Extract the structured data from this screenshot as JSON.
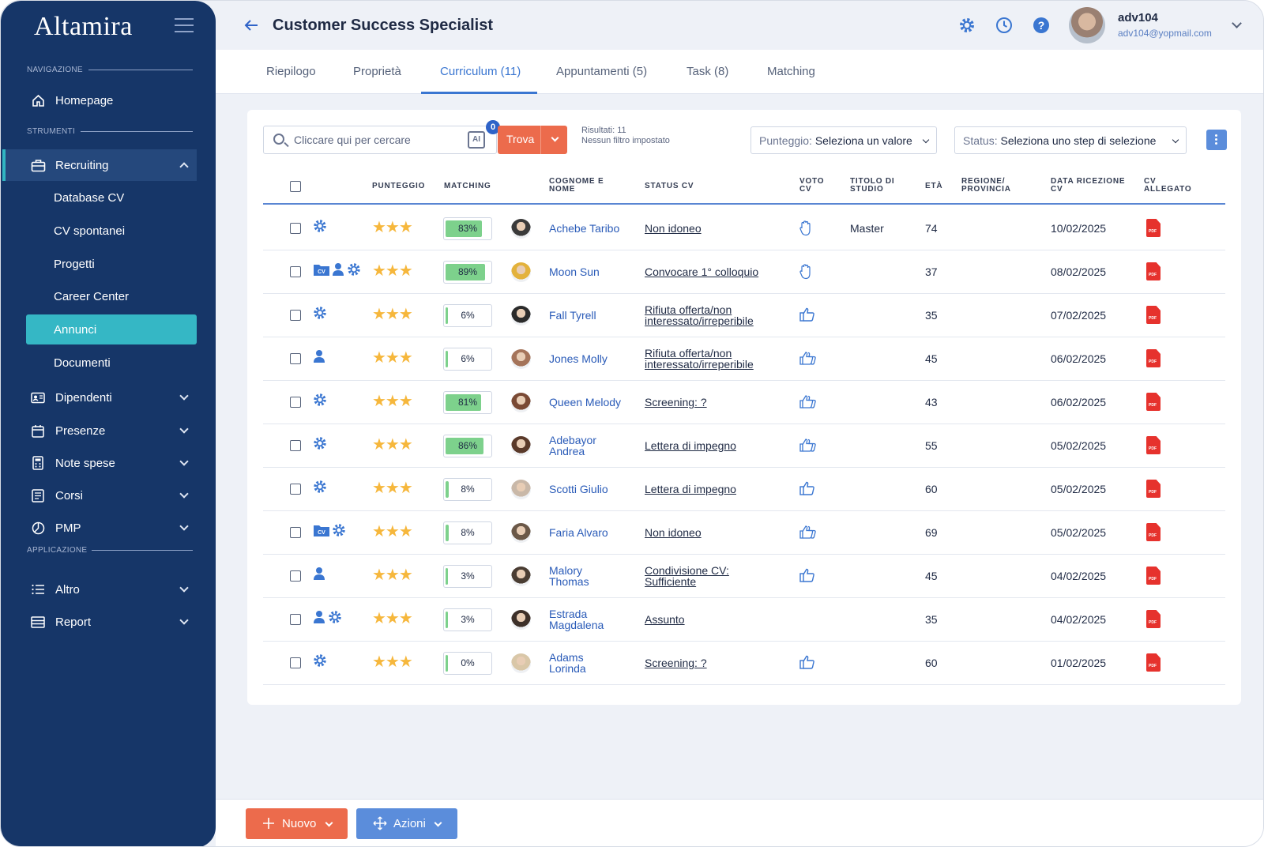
{
  "app": {
    "logo": "Altamira"
  },
  "sidebar": {
    "sections": {
      "nav": "NAVIGAZIONE",
      "tools": "STRUMENTI",
      "app": "APPLICAZIONE"
    },
    "homepage": "Homepage",
    "recruiting": "Recruiting",
    "recruiting_items": [
      "Database CV",
      "CV spontanei",
      "Progetti",
      "Career Center",
      "Annunci",
      "Documenti"
    ],
    "dipendenti": "Dipendenti",
    "presenze": "Presenze",
    "note_spese": "Note spese",
    "corsi": "Corsi",
    "pmp": "PMP",
    "altro": "Altro",
    "report": "Report"
  },
  "header": {
    "title": "Customer Success Specialist",
    "user_name": "adv104",
    "user_email": "adv104@yopmail.com"
  },
  "tabs": [
    "Riepilogo",
    "Proprietà",
    "Curriculum (11)",
    "Appuntamenti (5)",
    "Task (8)",
    "Matching"
  ],
  "toolbar": {
    "search_placeholder": "Cliccare qui per cercare",
    "ai_label": "AI",
    "ai_badge": "0",
    "trova": "Trova",
    "results": "Risultati: 11",
    "filter_note": "Nessun filtro impostato",
    "score_label": "Punteggio:",
    "score_value": "Seleziona un valore",
    "status_label": "Status:",
    "status_value": "Seleziona uno step di selezione"
  },
  "columns": {
    "punteggio": "PUNTEGGIO",
    "matching": "MATCHING",
    "nome_1": "COGNOME E",
    "nome_2": "NOME",
    "status": "STATUS CV",
    "voto_1": "VOTO",
    "voto_2": "CV",
    "titolo_1": "TITOLO DI",
    "titolo_2": "STUDIO",
    "eta": "ETÀ",
    "regione_1": "REGIONE/",
    "regione_2": "PROVINCIA",
    "data_1": "DATA RICEZIONE",
    "data_2": "CV",
    "allegato_1": "CV",
    "allegato_2": "ALLEGATO"
  },
  "rows": [
    {
      "icons": [
        "gear-icon"
      ],
      "stars": "★★★",
      "match": "83%",
      "match_fraction": 0.83,
      "name_1": "Achebe Taribo",
      "name_2": "",
      "status_1": "Non idoneo",
      "status_2": "",
      "vote": "hand-icon",
      "title": "Master",
      "age": "74",
      "date": "10/02/2025",
      "avatar_color": "#3a3a3a"
    },
    {
      "icons": [
        "cv-folder-icon",
        "person-icon",
        "gear-icon"
      ],
      "stars": "★★★",
      "match": "89%",
      "match_fraction": 0.89,
      "name_1": "Moon Sun",
      "name_2": "",
      "status_1": "Convocare 1° colloquio",
      "status_2": "",
      "vote": "hand-icon",
      "title": "",
      "age": "37",
      "date": "08/02/2025",
      "avatar_color": "#e3b23c"
    },
    {
      "icons": [
        "gear-icon"
      ],
      "stars": "★★★",
      "match": "6%",
      "match_fraction": 0.06,
      "name_1": "Fall Tyrell",
      "name_2": "",
      "status_1": "Rifiuta offerta/non",
      "status_2": "interessato/irreperibile",
      "vote": "thumb-up-icon",
      "title": "",
      "age": "35",
      "date": "07/02/2025",
      "avatar_color": "#2b2b2b"
    },
    {
      "icons": [
        "person-icon"
      ],
      "stars": "★★★",
      "match": "6%",
      "match_fraction": 0.06,
      "name_1": "Jones Molly",
      "name_2": "",
      "status_1": "Rifiuta offerta/non",
      "status_2": "interessato/irreperibile",
      "vote": "double-thumb-icon",
      "title": "",
      "age": "45",
      "date": "06/02/2025",
      "avatar_color": "#a5745a"
    },
    {
      "icons": [
        "gear-icon"
      ],
      "stars": "★★★",
      "match": "81%",
      "match_fraction": 0.81,
      "name_1": "Queen Melody",
      "name_2": "",
      "status_1": "Screening: ?",
      "status_2": "",
      "vote": "double-thumb-icon",
      "title": "",
      "age": "43",
      "date": "06/02/2025",
      "avatar_color": "#7a4a35"
    },
    {
      "icons": [
        "gear-icon"
      ],
      "stars": "★★★",
      "match": "86%",
      "match_fraction": 0.86,
      "name_1": "Adebayor",
      "name_2": "Andrea",
      "status_1": "Lettera di impegno",
      "status_2": "",
      "vote": "double-thumb-icon",
      "title": "",
      "age": "55",
      "date": "05/02/2025",
      "avatar_color": "#5a3a2a"
    },
    {
      "icons": [
        "gear-icon"
      ],
      "stars": "★★★",
      "match": "8%",
      "match_fraction": 0.08,
      "name_1": "Scotti Giulio",
      "name_2": "",
      "status_1": "Lettera di impegno",
      "status_2": "",
      "vote": "thumb-up-icon",
      "title": "",
      "age": "60",
      "date": "05/02/2025",
      "avatar_color": "#c9b8a8"
    },
    {
      "icons": [
        "cv-folder-icon",
        "gear-icon"
      ],
      "stars": "★★★",
      "match": "8%",
      "match_fraction": 0.08,
      "name_1": "Faria Alvaro",
      "name_2": "",
      "status_1": "Non idoneo",
      "status_2": "",
      "vote": "double-thumb-icon",
      "title": "",
      "age": "69",
      "date": "05/02/2025",
      "avatar_color": "#6b5848"
    },
    {
      "icons": [
        "person-icon"
      ],
      "stars": "★★★",
      "match": "3%",
      "match_fraction": 0.03,
      "name_1": "Malory",
      "name_2": "Thomas",
      "status_1": "Condivisione CV:",
      "status_2": "Sufficiente",
      "vote": "thumb-up-icon",
      "title": "",
      "age": "45",
      "date": "04/02/2025",
      "avatar_color": "#4a3d33"
    },
    {
      "icons": [
        "person-icon",
        "gear-icon"
      ],
      "stars": "★★★",
      "match": "3%",
      "match_fraction": 0.03,
      "name_1": "Estrada",
      "name_2": "Magdalena",
      "status_1": "Assunto",
      "status_2": "",
      "vote": "",
      "title": "",
      "age": "35",
      "date": "04/02/2025",
      "avatar_color": "#3d3029"
    },
    {
      "icons": [
        "gear-icon"
      ],
      "stars": "★★★",
      "match": "0%",
      "match_fraction": 0.0,
      "name_1": "Adams",
      "name_2": "Lorinda",
      "status_1": "Screening: ?",
      "status_2": "",
      "vote": "thumb-up-icon",
      "title": "",
      "age": "60",
      "date": "01/02/2025",
      "avatar_color": "#d9c7a8"
    }
  ],
  "actions": {
    "nuovo": "Nuovo",
    "azioni": "Azioni"
  },
  "colors": {
    "sidebar": "#163668",
    "accent": "#3a76d1",
    "teal": "#35b7c5",
    "orange": "#ec6b4c",
    "match_green": "#7dd18c"
  }
}
